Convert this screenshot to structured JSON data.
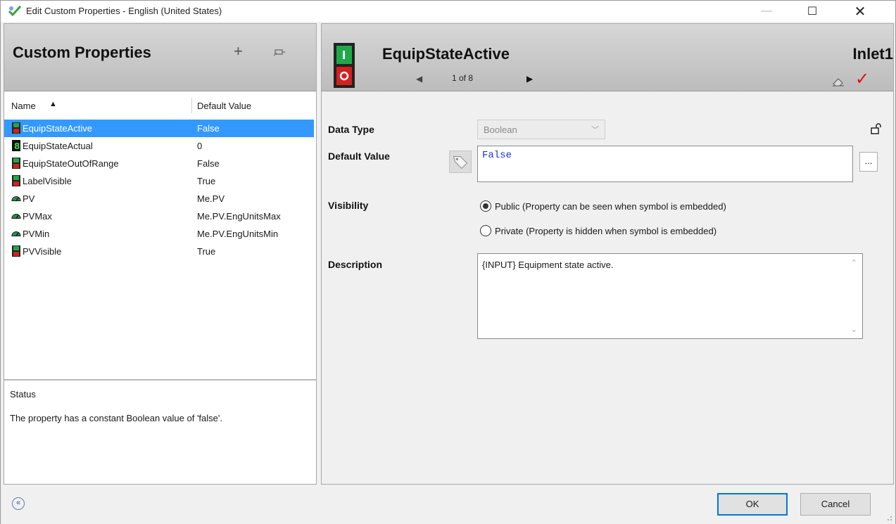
{
  "window": {
    "title": "Edit Custom Properties - English (United States)",
    "minimize": "—",
    "maximize": "☐",
    "close": "✕"
  },
  "left": {
    "title": "Custom Properties",
    "add_glyph": "+",
    "columns": {
      "name": "Name",
      "sort_glyph": "▲",
      "default": "Default Value"
    },
    "items": [
      {
        "name": "EquipStateActive",
        "value": "False",
        "icon": "switch-icon",
        "selected": true
      },
      {
        "name": "EquipStateActual",
        "value": "0",
        "icon": "integer-icon"
      },
      {
        "name": "EquipStateOutOfRange",
        "value": "False",
        "icon": "switch-icon"
      },
      {
        "name": "LabelVisible",
        "value": "True",
        "icon": "switch-icon"
      },
      {
        "name": "PV",
        "value": "Me.PV",
        "icon": "gauge-icon"
      },
      {
        "name": "PVMax",
        "value": "Me.PV.EngUnitsMax",
        "icon": "gauge-icon"
      },
      {
        "name": "PVMin",
        "value": "Me.PV.EngUnitsMin",
        "icon": "gauge-icon"
      },
      {
        "name": "PVVisible",
        "value": "True",
        "icon": "switch-icon"
      }
    ],
    "status": {
      "title": "Status",
      "text": "The property has a constant Boolean value of 'false'."
    }
  },
  "right": {
    "property_name": "EquipStateActive",
    "nav": {
      "prev": "◀",
      "count": "1 of 8",
      "next": "▶"
    },
    "symbol_name": "Inlet1",
    "check_glyph": "✓",
    "data_type": {
      "label": "Data Type",
      "value": "Boolean",
      "arrow": "﹀"
    },
    "default_value": {
      "label": "Default Value",
      "value": "False",
      "browse": "..."
    },
    "visibility": {
      "label": "Visibility",
      "public": "Public (Property can be seen when symbol is embedded)",
      "private": "Private (Property is hidden when symbol is embedded)",
      "selected": "public"
    },
    "description": {
      "label": "Description",
      "value": "{INPUT} Equipment state active.",
      "up": "⌃",
      "down": "⌄"
    }
  },
  "buttons": {
    "ok": "OK",
    "cancel": "Cancel",
    "collapse": "«"
  },
  "colors": {
    "selection": "#3399ff",
    "accent_red": "#dd1111",
    "value_blue": "#1a2fd1"
  }
}
